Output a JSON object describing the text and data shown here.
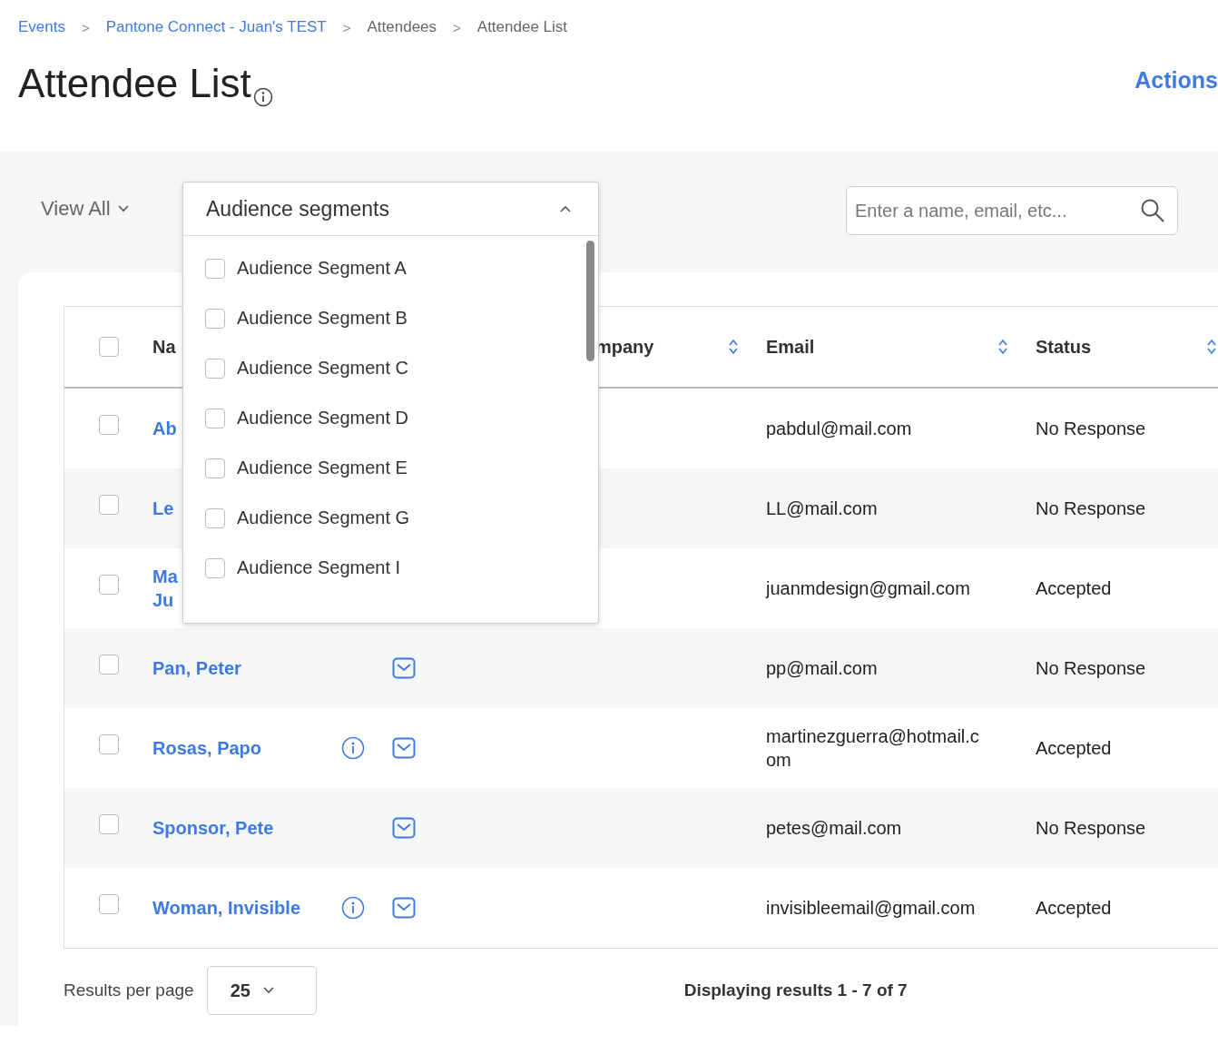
{
  "breadcrumb": [
    {
      "label": "Events",
      "link": true
    },
    {
      "label": "Pantone Connect - Juan's TEST",
      "link": true
    },
    {
      "label": "Attendees",
      "link": false
    },
    {
      "label": "Attendee List",
      "link": false
    }
  ],
  "breadcrumb_separator": ">",
  "title": "Attendee List",
  "actions_label": "Actions",
  "view_filter": {
    "label": "View All"
  },
  "segments_dropdown": {
    "label": "Audience segments",
    "expanded": true,
    "options": [
      {
        "label": "Audience Segment A",
        "checked": false
      },
      {
        "label": "Audience Segment B",
        "checked": false
      },
      {
        "label": "Audience Segment C",
        "checked": false
      },
      {
        "label": "Audience Segment D",
        "checked": false
      },
      {
        "label": "Audience Segment E",
        "checked": false
      },
      {
        "label": "Audience Segment G",
        "checked": false
      },
      {
        "label": "Audience Segment I",
        "checked": false
      }
    ]
  },
  "search": {
    "placeholder": "Enter a name, email, etc..."
  },
  "table": {
    "select_all_checked": false,
    "columns": [
      {
        "label": "Na"
      },
      {
        "label": "mpany",
        "sortable": true
      },
      {
        "label": "Email",
        "sortable": true
      },
      {
        "label": "Status",
        "sortable": true
      }
    ],
    "rows": [
      {
        "name": [
          "Ab"
        ],
        "email": [
          "pabdul@mail.com"
        ],
        "status": "No Response",
        "checked": false
      },
      {
        "name": [
          "Le"
        ],
        "email": [
          "LL@mail.com"
        ],
        "status": "No Response",
        "checked": false
      },
      {
        "name": [
          "Ma",
          "Ju"
        ],
        "email": [
          "juanmdesign@gmail.com"
        ],
        "status": "Accepted",
        "checked": false
      },
      {
        "name": [
          "Pan, Peter"
        ],
        "info_icon": false,
        "mail_icon": true,
        "email": [
          "pp@mail.com"
        ],
        "status": "No Response",
        "checked": false
      },
      {
        "name": [
          "Rosas, Papo"
        ],
        "info_icon": true,
        "mail_icon": true,
        "email": [
          "martinezguerra@hotmail.c",
          "om"
        ],
        "status": "Accepted",
        "checked": false
      },
      {
        "name": [
          "Sponsor, Pete"
        ],
        "info_icon": false,
        "mail_icon": true,
        "email": [
          "petes@mail.com"
        ],
        "status": "No Response",
        "checked": false
      },
      {
        "name": [
          "Woman, Invisible"
        ],
        "info_icon": true,
        "mail_icon": true,
        "email": [
          "invisibleemail@gmail.com"
        ],
        "status": "Accepted",
        "checked": false
      }
    ]
  },
  "footer": {
    "per_page_label": "Results per page",
    "per_page_value": "25",
    "summary": "Displaying results 1 - 7 of 7"
  }
}
